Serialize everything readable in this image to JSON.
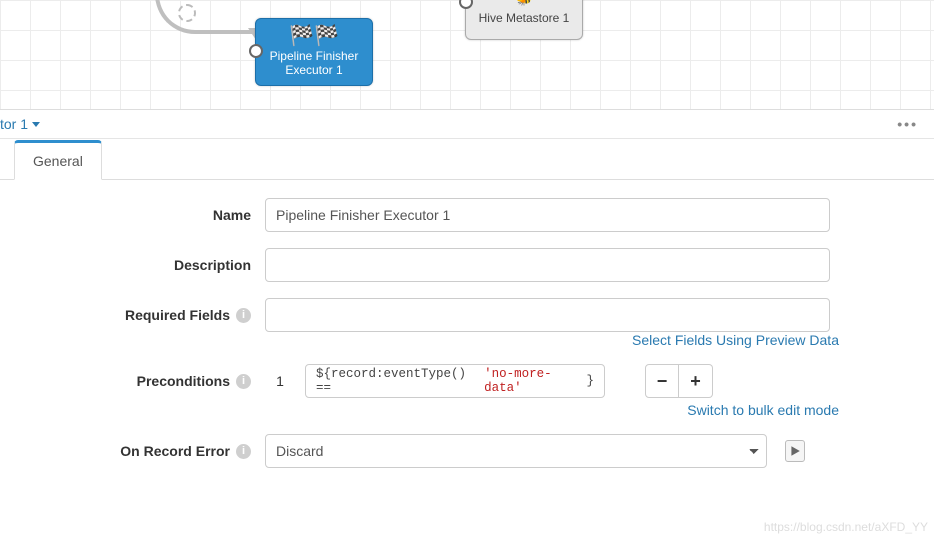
{
  "canvas": {
    "node_blue": {
      "line1": "Pipeline Finisher",
      "line2": "Executor 1"
    },
    "node_gray": {
      "line1": "Hive Metastore 1"
    }
  },
  "selector": {
    "text": "tor 1"
  },
  "tabs": {
    "general": "General"
  },
  "form": {
    "name_label": "Name",
    "name_value": "Pipeline Finisher Executor 1",
    "description_label": "Description",
    "description_value": "",
    "required_label": "Required Fields",
    "required_value": "",
    "select_fields_link": "Select Fields Using Preview Data",
    "preconditions_label": "Preconditions",
    "precond_index": "1",
    "precond_expr_prefix": "${record:eventType() == ",
    "precond_expr_literal": "'no-more-data'",
    "precond_expr_suffix": "}",
    "bulk_link": "Switch to bulk edit mode",
    "on_error_label": "On Record Error",
    "on_error_value": "Discard"
  },
  "watermark": "https://blog.csdn.net/aXFD_YY"
}
